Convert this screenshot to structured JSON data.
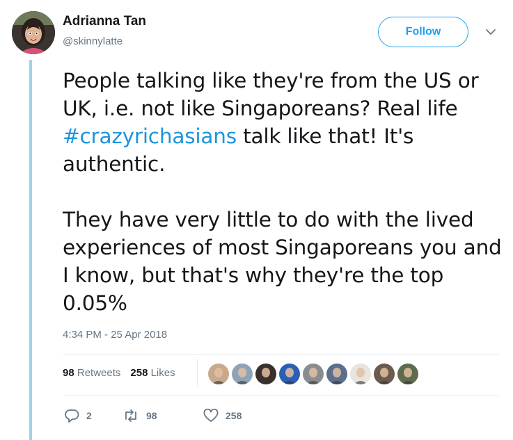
{
  "author": {
    "display_name": "Adrianna Tan",
    "handle": "@skinnylatte",
    "avatar": "profile-photo"
  },
  "follow_button": {
    "label": "Follow"
  },
  "menu": {
    "icon": "chevron-down-icon"
  },
  "tweet": {
    "paragraph1_before": "People talking like they're from the US or UK, i.e. not like Singaporeans? Real life ",
    "hashtag": "#crazyrichasians",
    "paragraph1_after": " talk like that! It's authentic.",
    "paragraph2": "They have very little to do with the lived experiences of most Singaporeans you and I know, but that's why they're the top 0.05%"
  },
  "timestamp": "4:34 PM - 25 Apr 2018",
  "stats": {
    "retweets_count": "98",
    "retweets_label": "Retweets",
    "likes_count": "258",
    "likes_label": "Likes"
  },
  "likers": [
    {
      "name": "liker-avatar-1",
      "color": "#c9a98b"
    },
    {
      "name": "liker-avatar-2",
      "color": "#8fa3b8"
    },
    {
      "name": "liker-avatar-3",
      "color": "#3a2f2a"
    },
    {
      "name": "liker-avatar-4",
      "color": "#2b5fb5"
    },
    {
      "name": "liker-avatar-5",
      "color": "#8a8d8f"
    },
    {
      "name": "liker-avatar-6",
      "color": "#5b6f8c"
    },
    {
      "name": "liker-avatar-7",
      "color": "#e8e4de"
    },
    {
      "name": "liker-avatar-8",
      "color": "#6b5a4e"
    },
    {
      "name": "liker-avatar-9",
      "color": "#5e6b4d"
    }
  ],
  "actions": {
    "reply": {
      "icon": "reply-icon",
      "count": "2"
    },
    "retweet": {
      "icon": "retweet-icon",
      "count": "98"
    },
    "like": {
      "icon": "heart-icon",
      "count": "258"
    }
  },
  "colors": {
    "accent": "#1da1f2",
    "hashtag": "#1b95e0",
    "muted": "#657786",
    "thread_line": "#9fd4e8"
  }
}
